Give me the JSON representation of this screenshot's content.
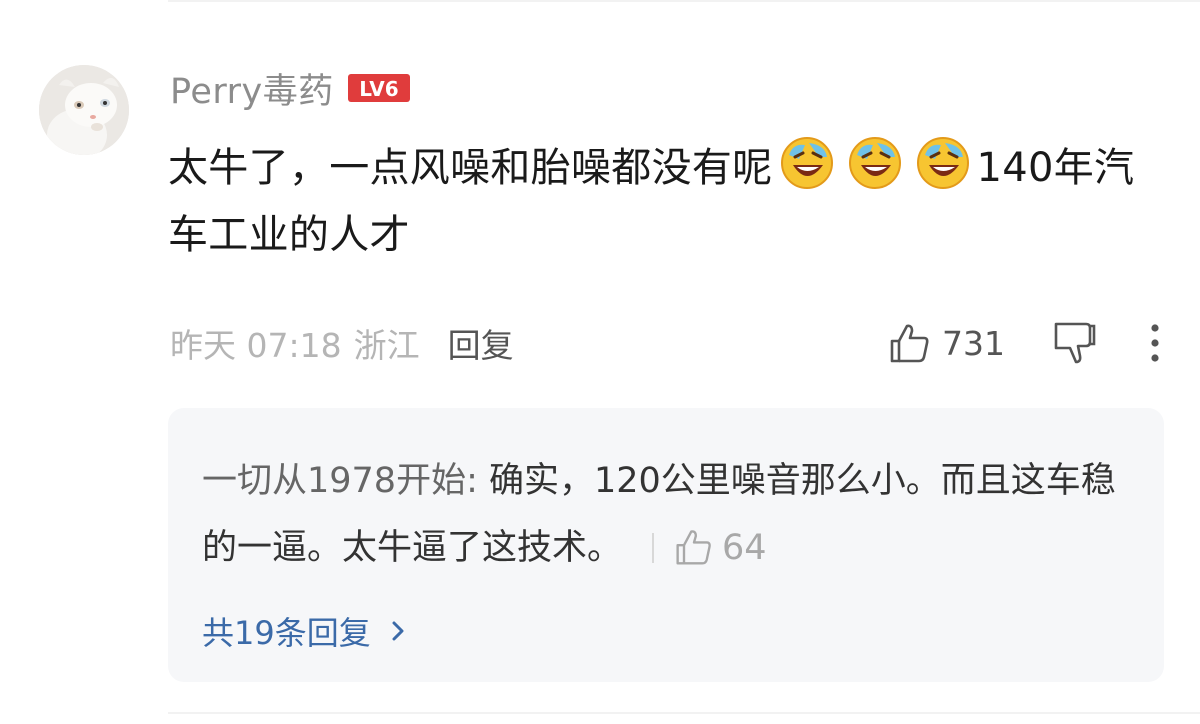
{
  "comment": {
    "username": "Perry毒药",
    "level_badge": "LV6",
    "text_before_emoji": "太牛了，一点风噪和胎噪都没有呢",
    "emoji_icon": "laugh-cry-emoji-icon",
    "text_after_emoji": "140年汽车工业的人才",
    "time": "昨天 07:18",
    "location": "浙江",
    "reply_label": "回复",
    "like_count": "731"
  },
  "reply_preview": {
    "author": "一切从1978开始",
    "colon": ": ",
    "text": "确实，120公里噪音那么小。而且这车稳的一逼。太牛逼了这技术。",
    "like_count": "64",
    "all_replies_label": "共19条回复"
  },
  "colors": {
    "badge_red": "#e03c3c",
    "link_blue": "#3b6aa8",
    "reply_bg": "#f6f7f9"
  }
}
